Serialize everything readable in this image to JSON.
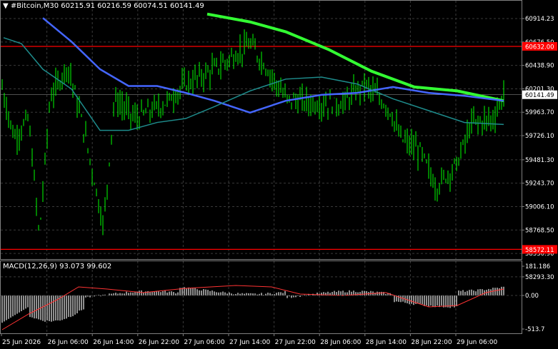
{
  "header": {
    "arrow": "▼",
    "symbol_tf": "#Bitcoin,M30",
    "ohlc": "60215.91 60216.59 60074.51 60141.49"
  },
  "macd": {
    "label": "MACD(12,26,9) 93.073 99.602"
  },
  "colors": {
    "background": "#000000",
    "grid": "#3a3a3a",
    "candle": "#00ff00",
    "ma_slow": "#33ff33",
    "ma_mid": "#4466ff",
    "ma_fast": "#1e8c8c",
    "level": "#ff0000",
    "macd_hist": "#c0c0c0",
    "macd_signal": "#ff3333"
  },
  "price_axis": {
    "ticks": [
      "60914.23",
      "60676.50",
      "60438.90",
      "60201.30",
      "59963.70",
      "59726.10",
      "59481.30",
      "59243.70",
      "59006.10",
      "58768.50",
      "58530.90",
      "58293.30"
    ],
    "levels": [
      {
        "label": "60632.00",
        "price": 60632.0
      },
      {
        "label": "58572.11",
        "price": 58572.11
      }
    ],
    "current": {
      "label": "60141.49",
      "price": 60141.49
    }
  },
  "macd_axis": {
    "ticks": [
      "181.186",
      "0.00",
      "-513.7"
    ]
  },
  "time_axis": {
    "labels": [
      "25 Jun 2026",
      "26 Jun 06:00",
      "26 Jun 14:00",
      "26 Jun 22:00",
      "27 Jun 06:00",
      "27 Jun 14:00",
      "27 Jun 22:00",
      "28 Jun 06:00",
      "28 Jun 14:00",
      "28 Jun 22:00",
      "29 Jun 06:00"
    ]
  }
}
